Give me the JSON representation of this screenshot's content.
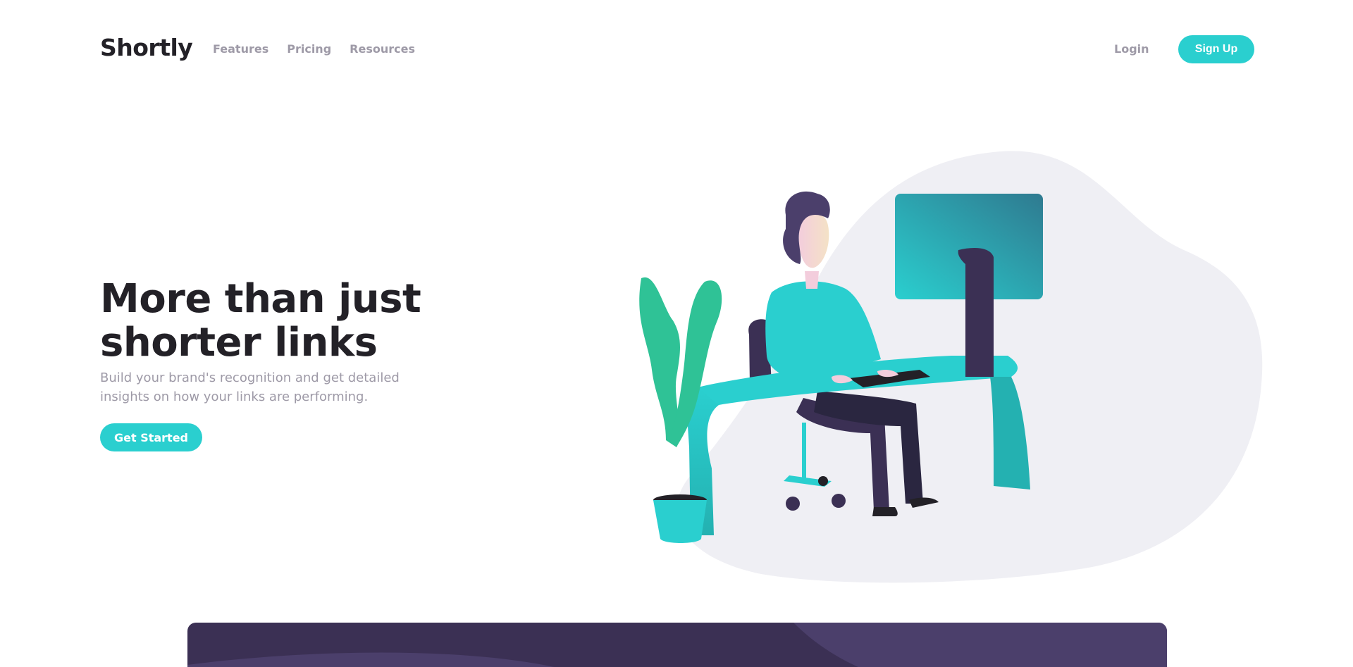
{
  "header": {
    "logo": "Shortly",
    "nav": [
      "Features",
      "Pricing",
      "Resources"
    ],
    "login_label": "Login",
    "signup_label": "Sign Up"
  },
  "hero": {
    "title": "More than just shorter links",
    "subtitle": "Build your brand's recognition and get detailed insights on how your links are performing.",
    "cta_label": "Get Started"
  },
  "colors": {
    "primary": "#2acfcf",
    "dark_violet": "#3b3054",
    "grayish_violet": "#9e9aa7",
    "very_dark_blue": "#232127",
    "blob_gray": "#efeff4"
  },
  "icons": [
    "working-person-illustration"
  ]
}
